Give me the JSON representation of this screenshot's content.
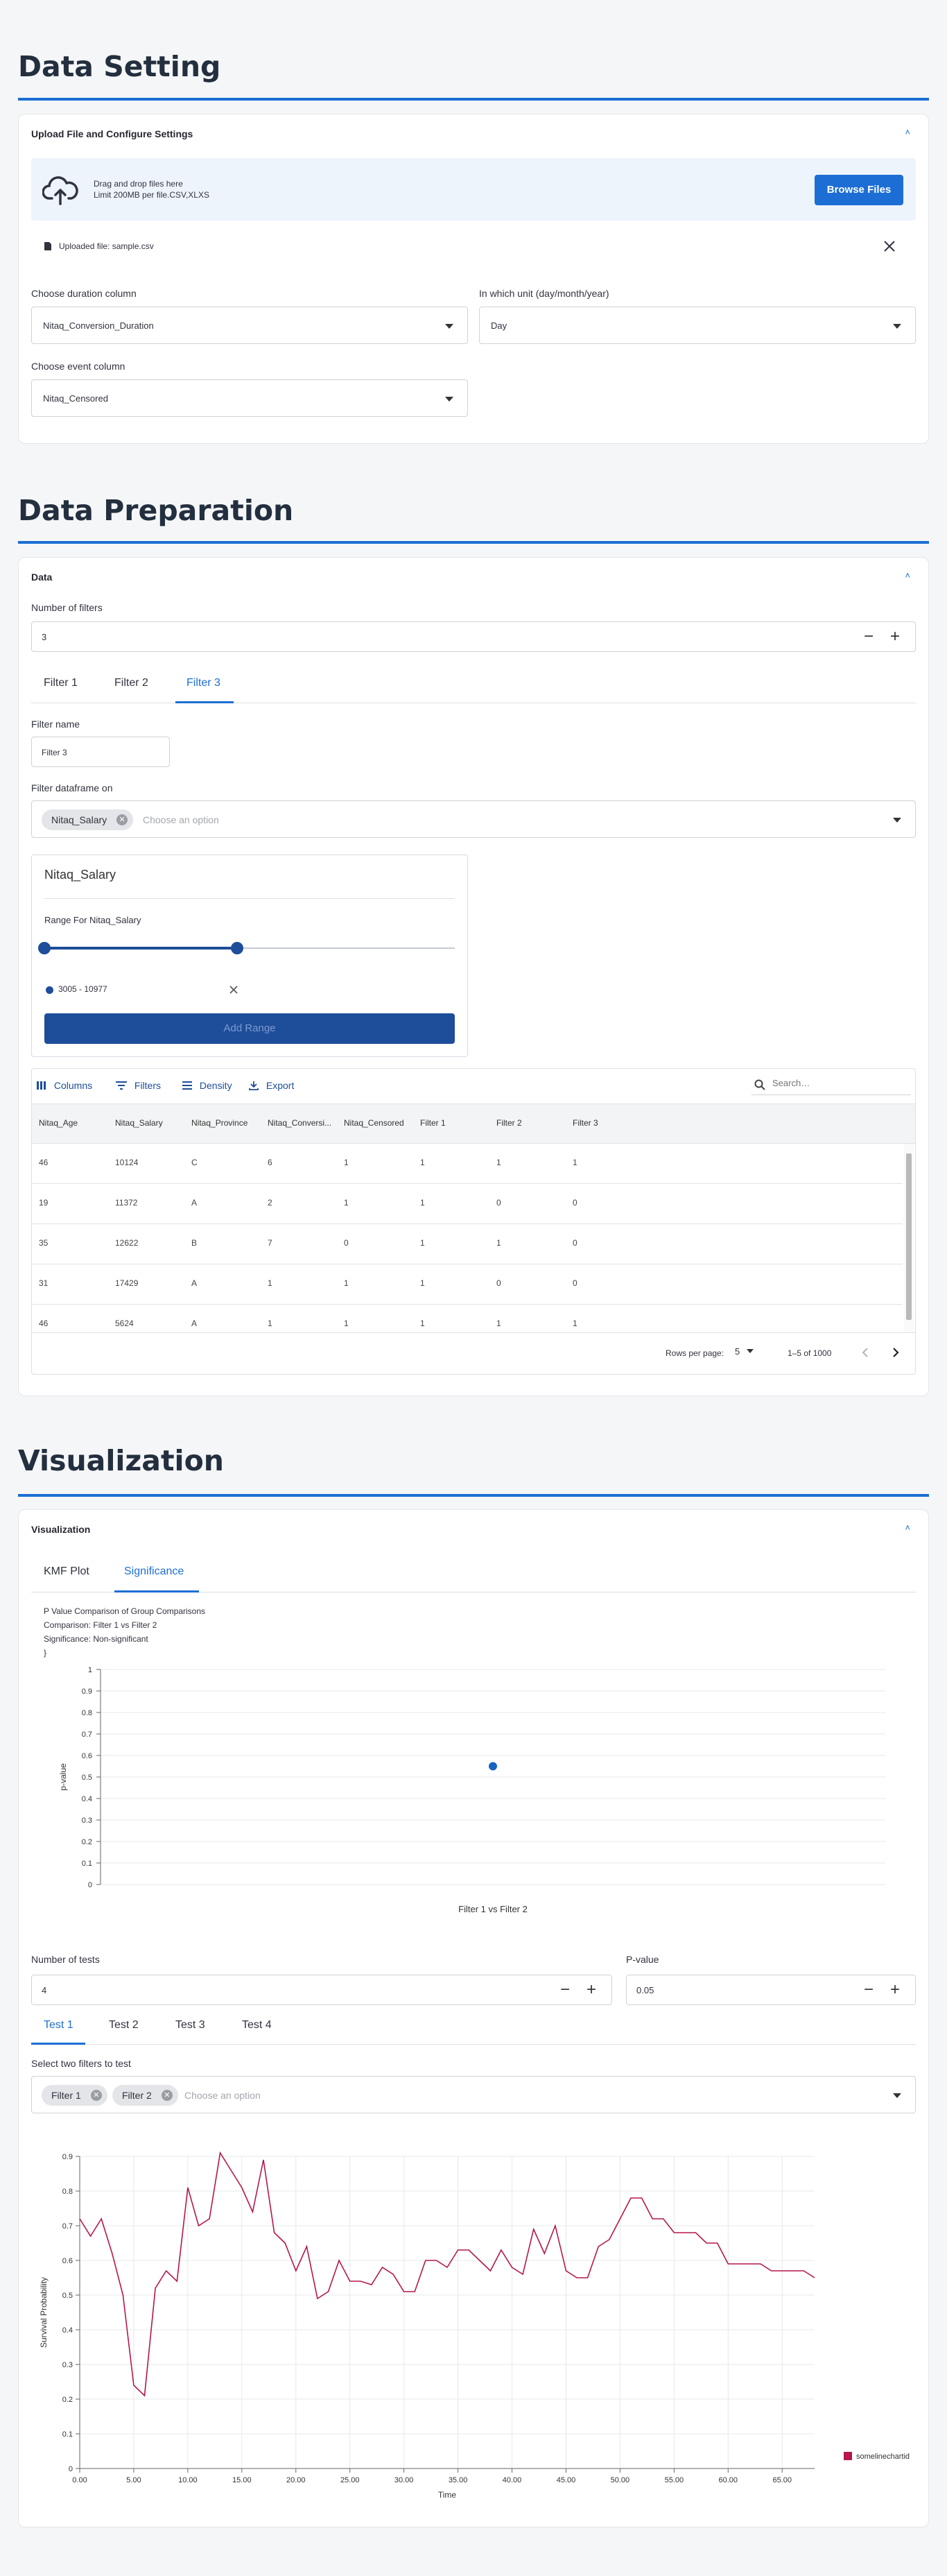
{
  "sections": {
    "data_setting": "Data Setting",
    "data_preparation": "Data Preparation",
    "visualization": "Visualization"
  },
  "upload_card": {
    "title": "Upload File and Configure Settings",
    "drop_line1": "Drag and drop files here",
    "drop_line2": "Limit 200MB per file.CSV,XLXS",
    "browse_label": "Browse Files",
    "uploaded_file": "Uploaded file: sample.csv",
    "duration_label": "Choose duration column",
    "duration_value": "Nitaq_Conversion_Duration",
    "unit_label": "In which unit (day/month/year)",
    "unit_value": "Day",
    "event_label": "Choose event column",
    "event_value": "Nitaq_Censored"
  },
  "data_card": {
    "title": "Data",
    "num_filters_label": "Number of filters",
    "num_filters_value": "3",
    "tabs": [
      "Filter 1",
      "Filter 2",
      "Filter 3"
    ],
    "active_tab": 2,
    "filter_name_label": "Filter name",
    "filter_name_value": "Filter 3",
    "filter_on_label": "Filter dataframe on",
    "filter_on_chips": [
      "Nitaq_Salary"
    ],
    "filter_on_placeholder": "Choose an option",
    "range_panel": {
      "title": "Nitaq_Salary",
      "range_label": "Range For Nitaq_Salary",
      "slider_low_fraction": 0,
      "slider_high_fraction": 0.47,
      "range_item": "3005 - 10977",
      "add_range_label": "Add Range"
    }
  },
  "grid": {
    "toolbar": {
      "columns": "Columns",
      "filters": "Filters",
      "density": "Density",
      "export": "Export",
      "search_placeholder": "Search…"
    },
    "headers": [
      "Nitaq_Age",
      "Nitaq_Salary",
      "Nitaq_Province",
      "Nitaq_Conversi...",
      "Nitaq_Censored",
      "Filter 1",
      "Filter 2",
      "Filter 3"
    ],
    "rows": [
      [
        "46",
        "10124",
        "C",
        "6",
        "1",
        "1",
        "1",
        "1"
      ],
      [
        "19",
        "11372",
        "A",
        "2",
        "1",
        "1",
        "0",
        "0"
      ],
      [
        "35",
        "12622",
        "B",
        "7",
        "0",
        "1",
        "1",
        "0"
      ],
      [
        "31",
        "17429",
        "A",
        "1",
        "1",
        "1",
        "0",
        "0"
      ],
      [
        "46",
        "5624",
        "A",
        "1",
        "1",
        "1",
        "1",
        "1"
      ]
    ],
    "footer": {
      "rows_per_page_label": "Rows per page:",
      "rows_per_page_value": "5",
      "range_text": "1–5 of 1000"
    }
  },
  "viz_card": {
    "title": "Visualization",
    "tabs": [
      "KMF Plot",
      "Significance"
    ],
    "active_tab": 1,
    "sig_info": {
      "line1": "P Value Comparison of Group Comparisons",
      "line2": "Comparison: Filter 1 vs Filter 2",
      "line3": "Significance: Non-significant"
    },
    "num_tests_label": "Number of tests",
    "num_tests_value": "4",
    "pvalue_label": "P-value",
    "pvalue_value": "0.05",
    "test_tabs": [
      "Test 1",
      "Test 2",
      "Test 3",
      "Test 4"
    ],
    "active_test": 0,
    "select_label": "Select two filters to test",
    "select_chips": [
      "Filter 1",
      "Filter 2"
    ],
    "select_placeholder": "Choose an option"
  },
  "chart_data": [
    {
      "type": "scatter",
      "title": "",
      "xlabel": "Filter 1 vs Filter 2",
      "ylabel": "p-value",
      "ylim": [
        0,
        1
      ],
      "yticks": [
        "0",
        "0.1",
        "0.2",
        "0.3",
        "0.4",
        "0.5",
        "0.6",
        "0.7",
        "0.8",
        "0.9",
        "1"
      ],
      "grid": true,
      "points": [
        {
          "x": "Filter 1 vs Filter 2",
          "y": 0.55
        }
      ],
      "color": "#1565c0"
    },
    {
      "type": "line",
      "title": "",
      "xlabel": "Time",
      "ylabel": "Survival Probability",
      "xlim": [
        0,
        68
      ],
      "ylim": [
        0,
        0.9
      ],
      "xticks": [
        "0.00",
        "5.00",
        "10.00",
        "15.00",
        "20.00",
        "25.00",
        "30.00",
        "35.00",
        "40.00",
        "45.00",
        "50.00",
        "55.00",
        "60.00",
        "65.00"
      ],
      "yticks": [
        "0",
        "0.1",
        "0.2",
        "0.3",
        "0.4",
        "0.5",
        "0.6",
        "0.7",
        "0.8",
        "0.9"
      ],
      "grid": true,
      "legend_position": "bottom-right",
      "series": [
        {
          "name": "somelinechartid",
          "color": "#b5174b",
          "x": [
            0,
            1,
            2,
            3,
            4,
            5,
            6,
            7,
            8,
            9,
            10,
            11,
            12,
            13,
            14,
            15,
            16,
            17,
            18,
            19,
            20,
            21,
            22,
            23,
            24,
            25,
            26,
            27,
            28,
            29,
            30,
            31,
            32,
            33,
            34,
            35,
            36,
            37,
            38,
            39,
            40,
            41,
            42,
            43,
            44,
            45,
            46,
            47,
            48,
            49,
            50,
            51,
            52,
            53,
            54,
            55,
            56,
            57,
            58,
            59,
            60,
            61,
            62,
            63,
            64,
            65,
            66,
            67,
            68
          ],
          "y": [
            0.72,
            0.67,
            0.72,
            0.62,
            0.5,
            0.24,
            0.21,
            0.52,
            0.57,
            0.54,
            0.81,
            0.7,
            0.72,
            0.91,
            0.86,
            0.81,
            0.74,
            0.89,
            0.68,
            0.65,
            0.57,
            0.64,
            0.49,
            0.51,
            0.6,
            0.54,
            0.54,
            0.53,
            0.58,
            0.56,
            0.51,
            0.51,
            0.6,
            0.6,
            0.58,
            0.63,
            0.63,
            0.6,
            0.57,
            0.63,
            0.58,
            0.56,
            0.69,
            0.62,
            0.7,
            0.57,
            0.55,
            0.55,
            0.64,
            0.66,
            0.72,
            0.78,
            0.78,
            0.72,
            0.72,
            0.68,
            0.68,
            0.68,
            0.65,
            0.65,
            0.59,
            0.59,
            0.59,
            0.59,
            0.57,
            0.57,
            0.57,
            0.57,
            0.55
          ]
        }
      ]
    }
  ]
}
